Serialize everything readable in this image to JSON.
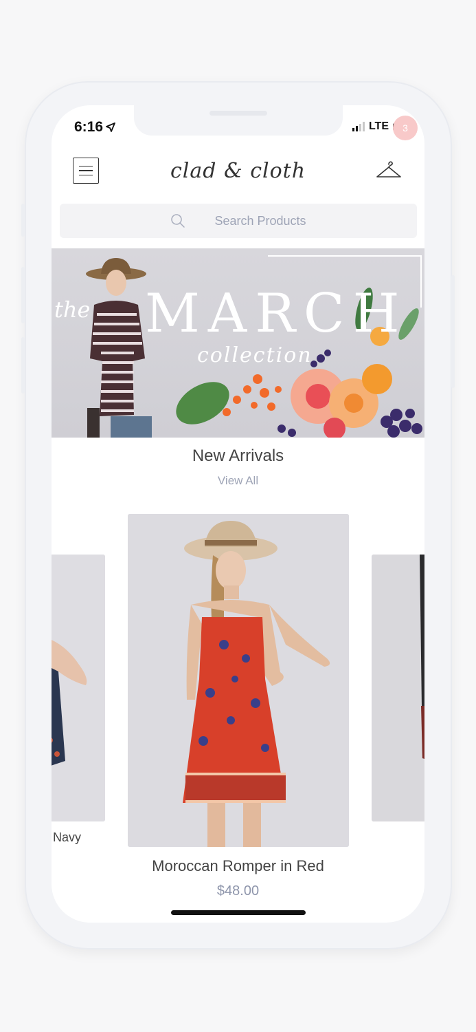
{
  "status": {
    "time": "6:16",
    "network": "LTE"
  },
  "header": {
    "brand": "clad & cloth",
    "cart_count": "3"
  },
  "search": {
    "placeholder": "Search Products"
  },
  "banner": {
    "the": "the",
    "title": "MARCH",
    "subtitle": "collection"
  },
  "section": {
    "title": "New Arrivals",
    "view_all": "View All"
  },
  "products": {
    "left_partial_name": "Navy",
    "featured": {
      "name": "Moroccan Romper in Red",
      "price": "$48.00"
    }
  },
  "colors": {
    "badge": "#f8c9c9",
    "muted": "#9ea4b6",
    "dress_red": "#d8402a"
  }
}
